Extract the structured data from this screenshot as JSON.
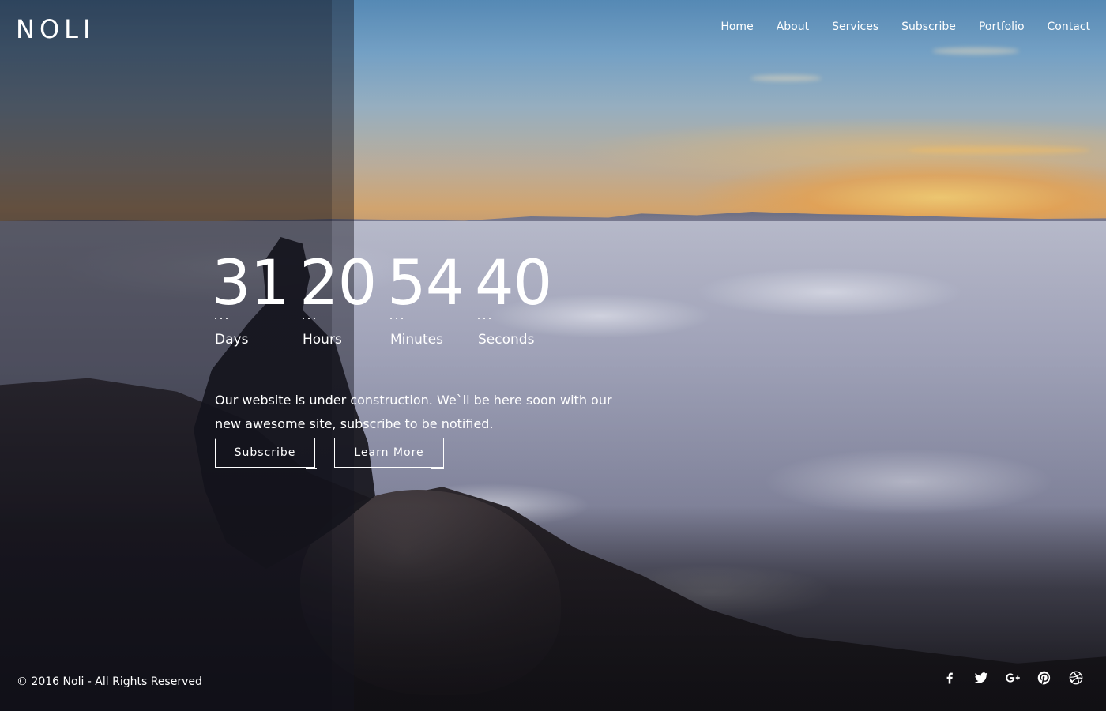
{
  "brand": {
    "logo": "NOLI"
  },
  "nav": {
    "items": [
      {
        "label": "Home",
        "active": true
      },
      {
        "label": "About",
        "active": false
      },
      {
        "label": "Services",
        "active": false
      },
      {
        "label": "Subscribe",
        "active": false
      },
      {
        "label": "Portfolio",
        "active": false
      },
      {
        "label": "Contact",
        "active": false
      }
    ]
  },
  "countdown": {
    "days": {
      "value": "31",
      "label": "Days"
    },
    "hours": {
      "value": "20",
      "label": "Hours"
    },
    "minutes": {
      "value": "54",
      "label": "Minutes"
    },
    "seconds": {
      "value": "40",
      "label": "Seconds"
    }
  },
  "message": "Our website is under construction. We`ll be here soon with our new awesome site, subscribe to be notified.",
  "buttons": {
    "subscribe": "Subscribe",
    "learn_more": "Learn More"
  },
  "footer": {
    "copyright": "© 2016 Noli - All Rights Reserved",
    "social": [
      "facebook-icon",
      "twitter-icon",
      "google-plus-icon",
      "pinterest-icon",
      "dribbble-icon"
    ]
  },
  "colors": {
    "text": "#ffffff",
    "panel": "#14141e"
  }
}
